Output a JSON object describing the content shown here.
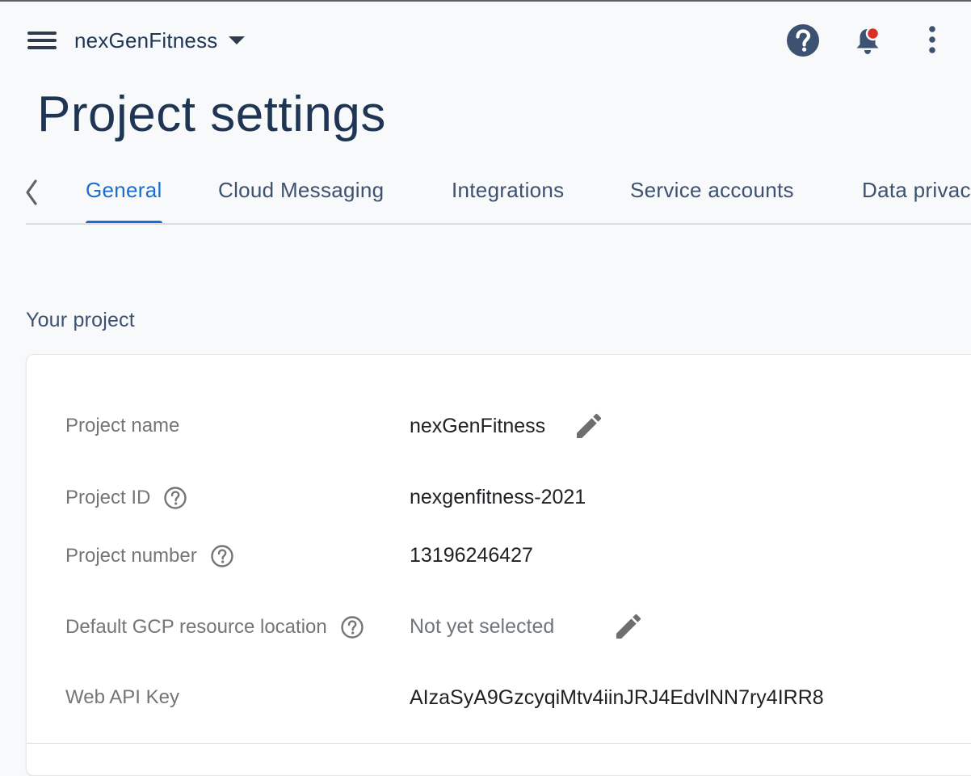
{
  "topbar": {
    "project_name": "nexGenFitness",
    "menu_icon": "hamburger-menu-icon",
    "help_icon": "help-circle-icon",
    "notification_icon": "bell-icon",
    "notification_badge_color": "#d93025",
    "more_icon": "more-vert-icon"
  },
  "page": {
    "title": "Project settings"
  },
  "tabs": {
    "prev_icon": "chevron-left-icon",
    "items": [
      {
        "label": "General",
        "active": true
      },
      {
        "label": "Cloud Messaging",
        "active": false
      },
      {
        "label": "Integrations",
        "active": false
      },
      {
        "label": "Service accounts",
        "active": false
      },
      {
        "label": "Data privac",
        "active": false
      }
    ],
    "active_color": "#1a6ed0"
  },
  "section": {
    "heading": "Your project"
  },
  "project": {
    "rows": [
      {
        "label": "Project name",
        "value": "nexGenFitness",
        "has_help": false,
        "editable": true
      },
      {
        "label": "Project ID",
        "value": "nexgenfitness-2021",
        "has_help": true,
        "editable": false
      },
      {
        "label": "Project number",
        "value": "13196246427",
        "has_help": true,
        "editable": false
      },
      {
        "label": "Default GCP resource location",
        "value": "Not yet selected",
        "has_help": true,
        "editable": true
      },
      {
        "label": "Web API Key",
        "value": "AIzaSyA9GzcyqiMtv4iinJRJ4EdvlNN7ry4IRR8",
        "has_help": false,
        "editable": false
      }
    ]
  }
}
